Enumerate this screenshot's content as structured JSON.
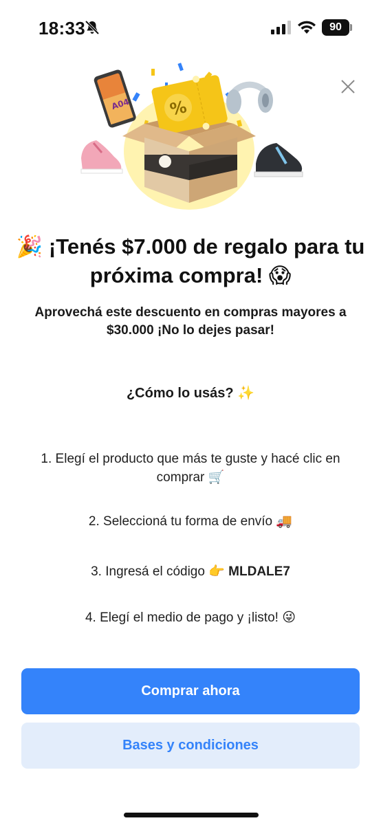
{
  "status_bar": {
    "time": "18:33",
    "battery": "90",
    "icons": [
      "bell-muted-icon",
      "signal-icon",
      "wifi-icon",
      "battery-icon"
    ]
  },
  "close_icon": "close-icon",
  "hero": {
    "coupon_symbol": "%"
  },
  "title": {
    "emoji_left": "🎉",
    "text": "¡Tenés $7.000 de regalo para tu próxima compra!",
    "emoji_right": "😱"
  },
  "subtitle": "Aprovechá este descuento en compras mayores a $30.000 ¡No lo dejes pasar!",
  "how": {
    "heading": "¿Cómo lo usás?",
    "heading_emoji": "✨"
  },
  "steps": [
    {
      "text": "1. Elegí el producto que más te guste y hacé clic en comprar",
      "emoji": "🛒"
    },
    {
      "text": "2. Seleccioná tu forma de envío",
      "emoji": "🚚"
    },
    {
      "text": "3. Ingresá el código",
      "emoji": "👉",
      "code": "MLDALE7"
    },
    {
      "text": "4. Elegí el medio de pago y ¡listo!",
      "emoji": "😜"
    }
  ],
  "buttons": {
    "primary": "Comprar ahora",
    "secondary": "Bases y condiciones"
  },
  "colors": {
    "accent": "#3483fa",
    "secondary_bg": "#e3edfb",
    "coupon": "#f5c518",
    "glow": "#fff2a8"
  }
}
